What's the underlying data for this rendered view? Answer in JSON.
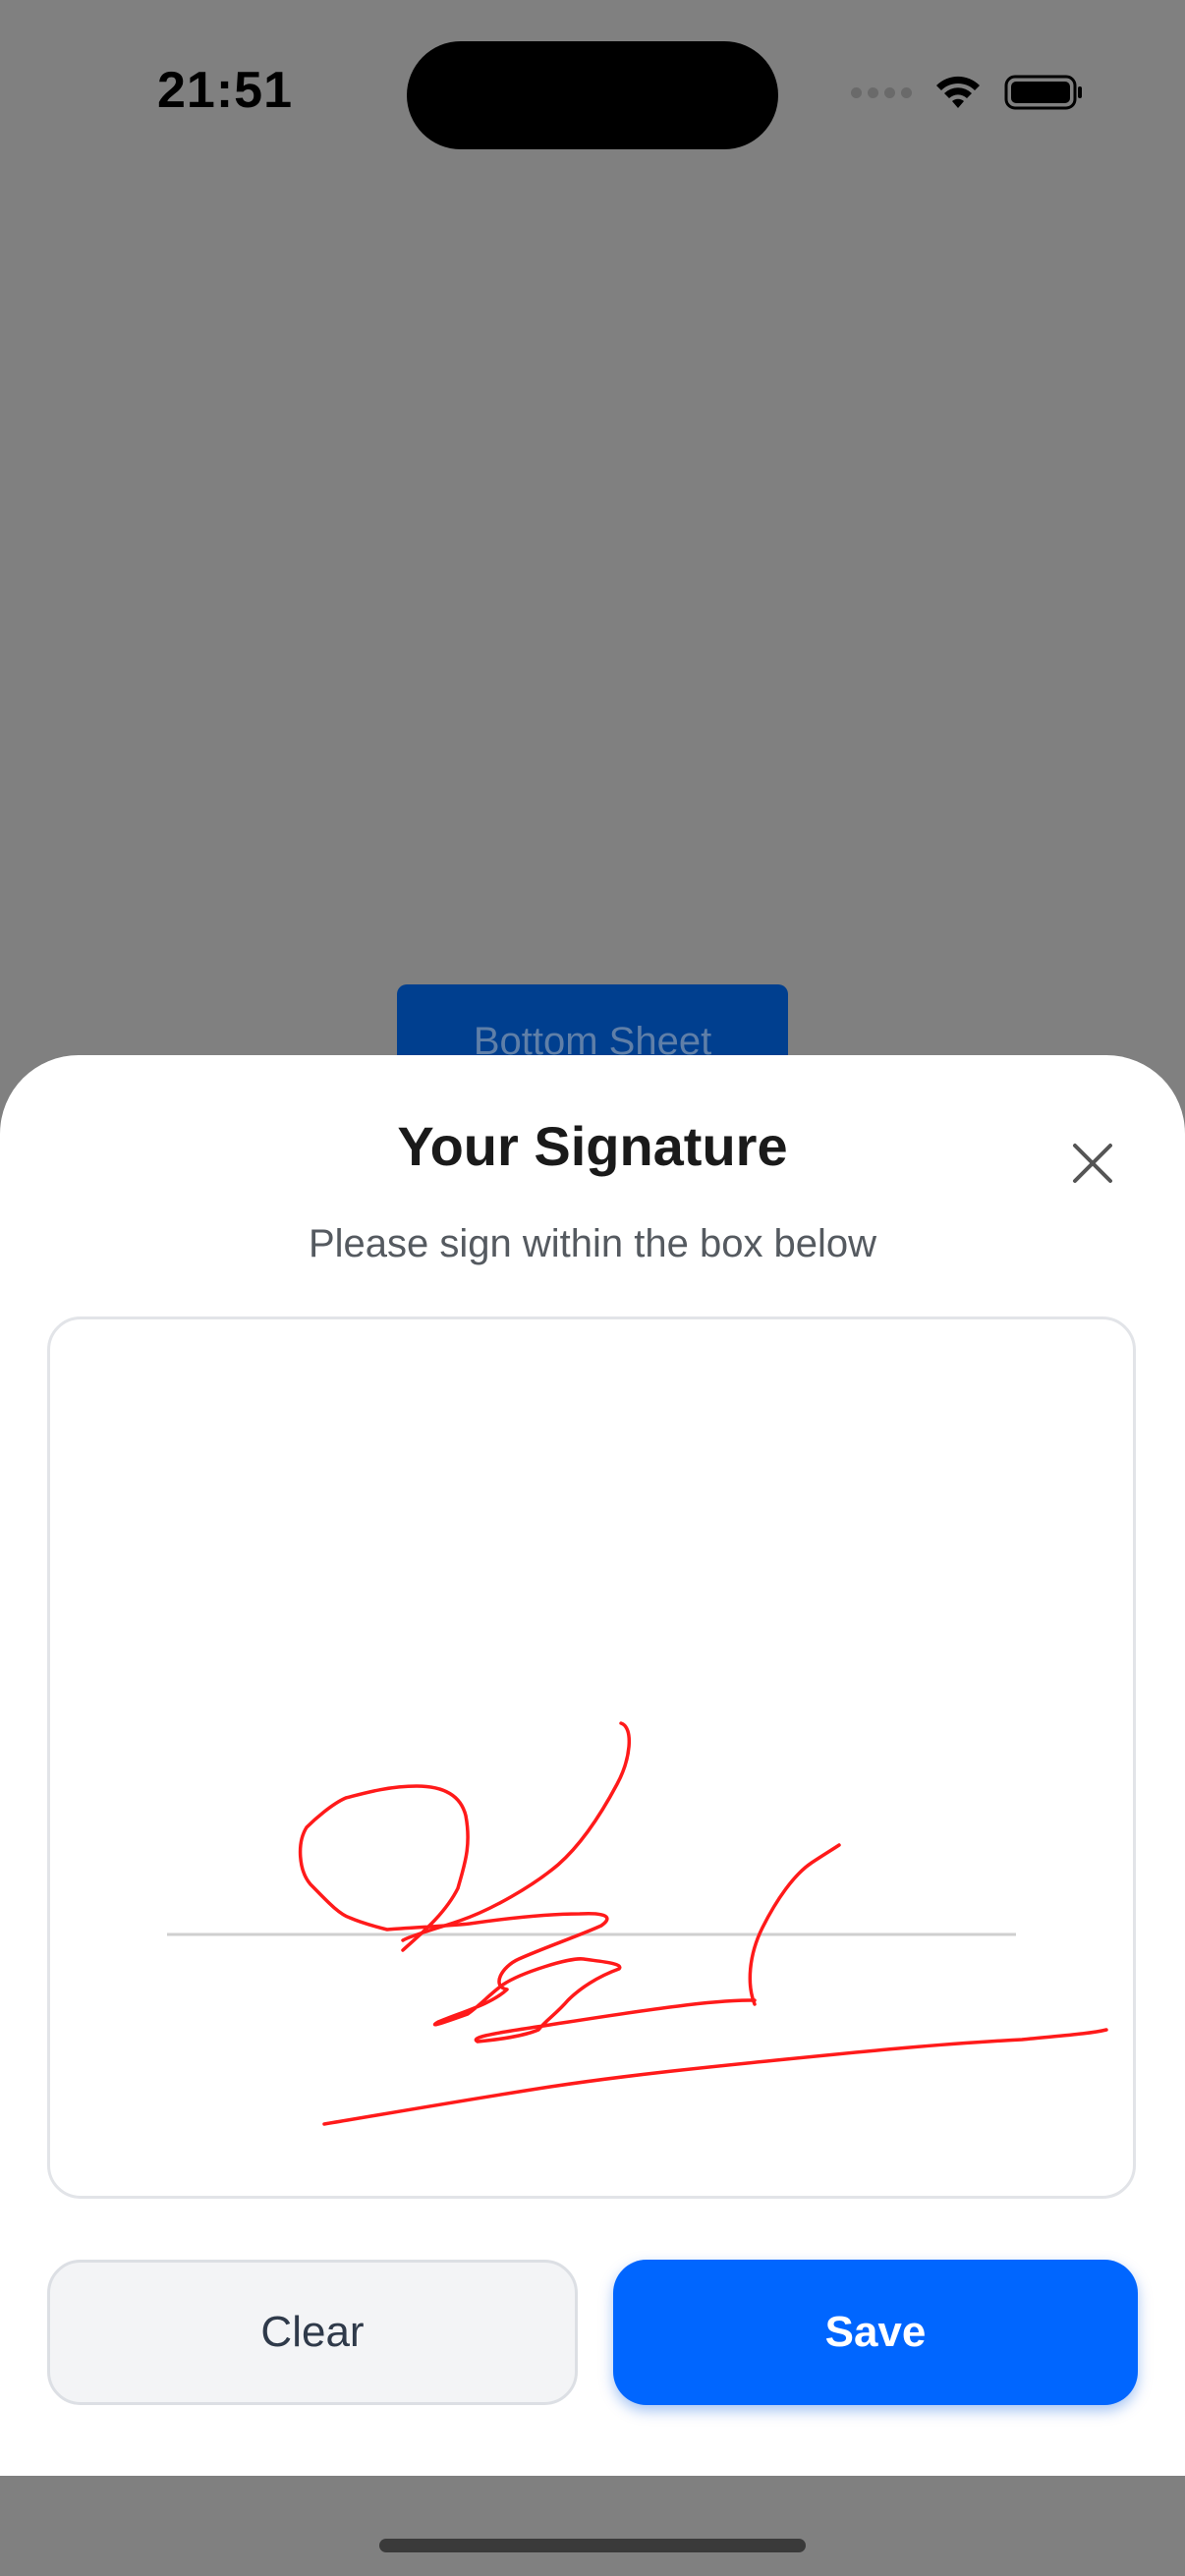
{
  "status_bar": {
    "time": "21:51",
    "icons": [
      "signal-icon",
      "wifi-icon",
      "battery-icon"
    ]
  },
  "background": {
    "button_label": "Bottom Sheet"
  },
  "sheet": {
    "title": "Your Signature",
    "subtitle": "Please sign within the box below",
    "close_icon": "close-icon"
  },
  "actions": {
    "clear_label": "Clear",
    "save_label": "Save"
  },
  "colors": {
    "accent": "#0066FF",
    "stroke": "#FF0000",
    "overlay": "#808080"
  }
}
